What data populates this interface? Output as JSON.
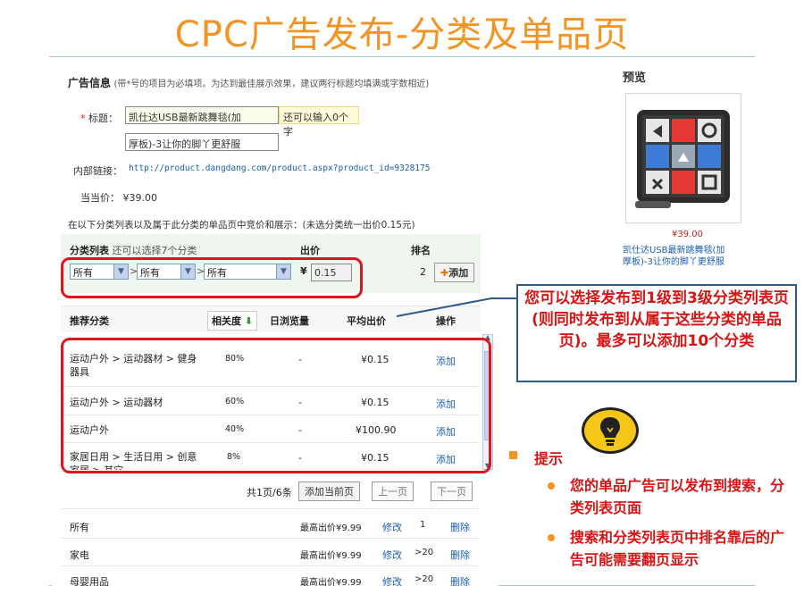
{
  "slide": {
    "title": "CPC广告发布-分类及单品页"
  },
  "form": {
    "section_title": "广告信息",
    "section_note": "(带*号的项目为必填项。为达到最佳展示效果，建议两行标题均填满或字数相近)",
    "star": "*",
    "title_label": "标题：",
    "title_line1": "凯仕达USB最新跳舞毯(加",
    "title_hint": "还可以输入0个字",
    "title_line2": "厚板)-3让你的脚丫更舒服",
    "internal_link_label": "内部链接：",
    "internal_link_value": "http://product.dangdang.com/product.aspx?product_id=9328175",
    "price_label": "当当价：",
    "price_value": "¥39.00",
    "category_intro": "在以下分类列表以及属于此分类的单品页中竞价和展示：(未选分类统一出价0.15元)"
  },
  "category_bar": {
    "col_category": "分类列表",
    "col_category_note": "还可以选择7个分类",
    "col_bid": "出价",
    "col_rank": "排名",
    "select1": "所有",
    "select2": "所有",
    "select3": "所有",
    "currency": "¥",
    "bid_value": "0.15",
    "rank_value": "2",
    "add_button": "添加",
    "arrow": "▼",
    "sep": ">"
  },
  "recommend": {
    "headers": {
      "category": "推荐分类",
      "relevance": "相关度",
      "relevance_arrow": "⬇",
      "daily_views": "日浏览量",
      "avg_bid": "平均出价",
      "action": "操作"
    },
    "rows": [
      {
        "category": "运动户外 > 运动器材 > 健身器具",
        "relevance": "80%",
        "views": "-",
        "avg": "¥0.15",
        "action": "添加"
      },
      {
        "category": "运动户外 > 运动器材",
        "relevance": "60%",
        "views": "-",
        "avg": "¥0.15",
        "action": "添加"
      },
      {
        "category": "运动户外",
        "relevance": "40%",
        "views": "-",
        "avg": "¥100.90",
        "action": "添加"
      },
      {
        "category": "家居日用 > 生活日用 > 创意家居 > 其它",
        "relevance": "8%",
        "views": "-",
        "avg": "¥0.15",
        "action": "添加"
      }
    ],
    "pager_text": "共1页/6条",
    "add_page_button": "添加当前页",
    "prev_button": "上一页",
    "next_button": "下一页"
  },
  "selected": {
    "rows": [
      {
        "name": "所有",
        "bid": "最高出价¥9.99",
        "edit": "修改",
        "rank": "1",
        "delete": "删除"
      },
      {
        "name": "家电",
        "bid": "最高出价¥9.99",
        "edit": "修改",
        "rank": ">20",
        "delete": "删除"
      },
      {
        "name": "母婴用品",
        "bid": "最高出价¥9.99",
        "edit": "修改",
        "rank": ">20",
        "delete": "删除"
      }
    ]
  },
  "preview": {
    "title": "预览",
    "price": "¥39.00",
    "name_line1": "凯仕达USB最新跳舞毯(加",
    "name_line2": "厚板)-3让你的脚丫更舒服"
  },
  "callout": {
    "text": "您可以选择发布到1级到3级分类列表页(则同时发布到从属于这些分类的单品页)。最多可以添加10个分类"
  },
  "tips": {
    "title": "提示",
    "items": [
      "您的单品广告可以发布到搜索，分类列表页面",
      "搜索和分类列表页中排名靠后的广告可能需要翻页显示"
    ]
  },
  "colors": {
    "accent_orange": "#f39322",
    "highlight_red": "#e0141c",
    "tip_red": "#d81414",
    "link_blue": "#1a5fb4"
  }
}
